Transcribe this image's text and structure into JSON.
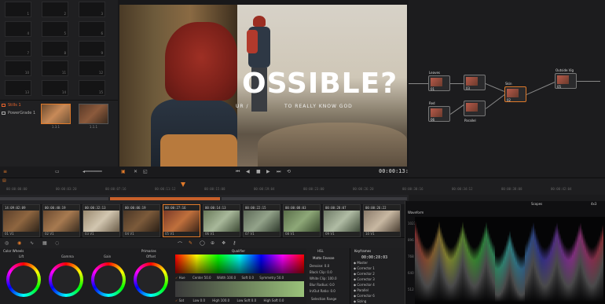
{
  "gallery": {
    "album_still": "Stills 1",
    "album_powergrade": "PowerGrade 1",
    "still_numbers": [
      "1",
      "2",
      "3",
      "4",
      "5",
      "6",
      "7",
      "8",
      "9",
      "10",
      "11",
      "12",
      "13",
      "14",
      "15"
    ],
    "thumbs": [
      {
        "label": "1.3.1",
        "sub": "1.3.1"
      },
      {
        "label": "1.1.1",
        "sub": ""
      }
    ]
  },
  "viewer": {
    "overlay_big": "OSSIBLE?",
    "overlay_left": "UR /",
    "overlay_sub": "TO REALLY KNOW GOD",
    "timecode": "00:00:13:11"
  },
  "nodes": {
    "items": [
      {
        "label": "Leaves",
        "num": "01"
      },
      {
        "label": "Red",
        "num": "06"
      },
      {
        "label": "",
        "num": "03"
      },
      {
        "label": "Parallel",
        "num": ""
      },
      {
        "label": "Skin",
        "num": "02"
      },
      {
        "label": "Outside Vig",
        "num": "05"
      }
    ]
  },
  "timeline": {
    "ticks": [
      "00:00:00:00",
      "00:00:03:20",
      "00:00:07:16",
      "00:00:11:12",
      "00:00:15:08",
      "00:00:19:04",
      "00:00:23:00",
      "00:00:26:20",
      "00:00:30:16",
      "00:00:34:12",
      "00:00:38:08",
      "00:00:42:04"
    ],
    "clips": [
      {
        "tc": "14:09:02:09",
        "id": "01  V1"
      },
      {
        "tc": "00:00:40:19",
        "id": "02  V1"
      },
      {
        "tc": "00:00:32:13",
        "id": "03  V1"
      },
      {
        "tc": "00:00:06:19",
        "id": "04  V1"
      },
      {
        "tc": "00:00:27:16",
        "id": "05  V1"
      },
      {
        "tc": "00:00:14:13",
        "id": "06  V1"
      },
      {
        "tc": "00:00:22:15",
        "id": "07  V1"
      },
      {
        "tc": "00:00:08:03",
        "id": "08  V1"
      },
      {
        "tc": "00:00:28:07",
        "id": "09  V1"
      },
      {
        "tc": "00:00:26:22",
        "id": "10  V1"
      }
    ]
  },
  "color": {
    "wheels_title": "Color Wheels",
    "primaries": "Primaries",
    "wheel_labels": [
      "Lift",
      "Gamma",
      "Gain",
      "Offset"
    ],
    "qualifier_title": "Qualifier",
    "hue_row": {
      "label": "Hue",
      "center": "Center 50.0",
      "width": "Width 100.0",
      "soft": "Soft 0.0",
      "sym": "Symmetry 50.0"
    },
    "sat_row": {
      "label": "Sat",
      "low": "Low 0.0",
      "high": "High 100.0",
      "lsoft": "Low Soft 0.0",
      "hsoft": "High Soft 0.0"
    },
    "hsl_title": "HSL",
    "matte_title": "Matte Finesse",
    "hsl_rows": [
      "Denoise: 0.0",
      "Black Clip: 0.0",
      "White Clip: 100.0",
      "Blur Radius: 0.0",
      "In/Out Ratio: 0.0"
    ],
    "selection_range": "Selection Range",
    "keyframes_title": "Keyframes",
    "keyframes_tc": "00:00:28:03",
    "kf_items": [
      "Master",
      "Corrector 1",
      "Corrector 2",
      "Corrector 3",
      "Corrector 4",
      "Parallel",
      "Corrector 6",
      "Sizing"
    ]
  },
  "scopes": {
    "title": "Scopes",
    "mode": "Waveform",
    "count": "4x3",
    "levels": [
      "1023",
      "896",
      "768",
      "640",
      "512"
    ]
  }
}
